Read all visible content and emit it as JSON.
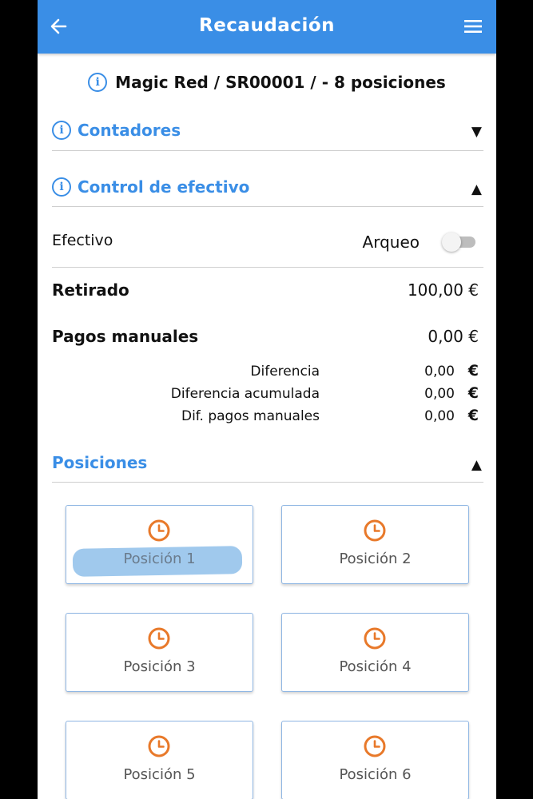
{
  "appbar": {
    "title": "Recaudación",
    "back_icon": "arrow-left-icon",
    "menu_icon": "hamburger-menu-icon",
    "color": "#3a8ee6"
  },
  "header": {
    "icon": "info-icon",
    "text": "Magic Red / SR00001 / - 8 posiciones"
  },
  "sections": {
    "contadores": {
      "title": "Contadores",
      "arrow": "▼"
    },
    "control": {
      "title": "Control de efectivo",
      "arrow": "▲"
    },
    "posiciones": {
      "title": "Posiciones",
      "arrow": "▲"
    }
  },
  "efectivo": {
    "label": "Efectivo",
    "arqueo_label": "Arqueo",
    "arqueo_toggle": "off"
  },
  "retirado": {
    "label": "Retirado",
    "value": "100,00 €"
  },
  "pagos_manuales": {
    "label": "Pagos manuales",
    "value": "0,00 €"
  },
  "details": [
    {
      "label": "Diferencia",
      "value": "0,00",
      "currency": "€"
    },
    {
      "label": "Diferencia acumulada",
      "value": "0,00",
      "currency": "€"
    },
    {
      "label": "Dif. pagos manuales",
      "value": "0,00",
      "currency": "€"
    }
  ],
  "positions": [
    {
      "label": "Posición 1",
      "icon": "clock-icon",
      "highlighted": true
    },
    {
      "label": "Posición 2",
      "icon": "clock-icon"
    },
    {
      "label": "Posición 3",
      "icon": "clock-icon"
    },
    {
      "label": "Posición 4",
      "icon": "clock-icon"
    },
    {
      "label": "Posición 5",
      "icon": "clock-icon"
    },
    {
      "label": "Posición 6",
      "icon": "clock-icon"
    }
  ],
  "colors": {
    "accent": "#3a8ee6",
    "clock": "#e8792a"
  }
}
